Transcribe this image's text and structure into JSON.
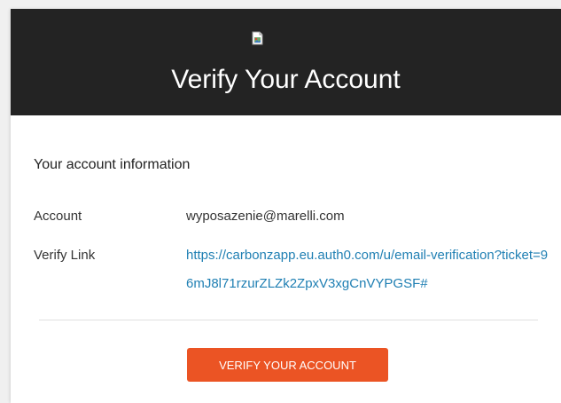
{
  "header": {
    "logo_icon": "broken-image-icon",
    "title": "Verify Your Account",
    "background": "#232323"
  },
  "info": {
    "heading": "Your account information",
    "account_label": "Account",
    "account_value": "wyposazenie@marelli.com",
    "verify_label": "Verify Link",
    "verify_link_text": "https://carbonzapp.eu.auth0.com/u/email-verification?ticket=96mJ8l71rzurZLZk2ZpxV3xgCnVYPGSF#"
  },
  "action": {
    "button_label": "VERIFY YOUR ACCOUNT",
    "button_color": "#eb5424"
  },
  "colors": {
    "link": "#1f7fb3",
    "page_background": "#f0f0f0"
  }
}
